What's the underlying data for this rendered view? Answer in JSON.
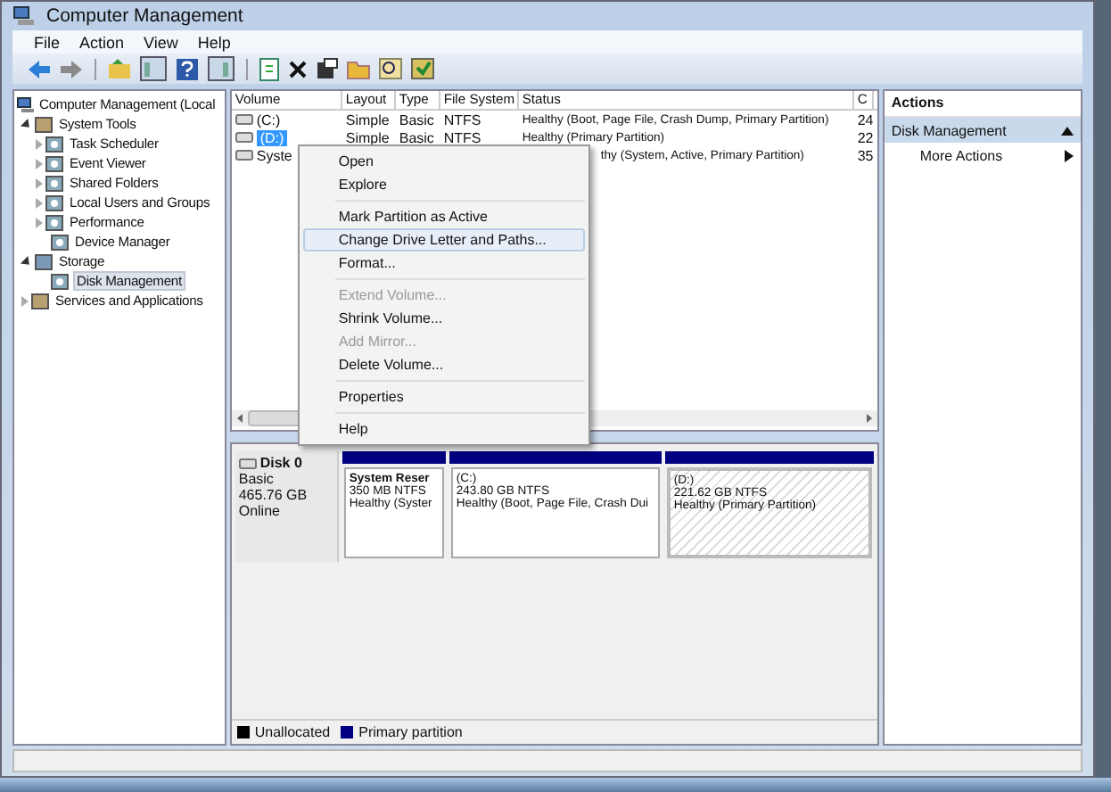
{
  "window": {
    "title": "Computer Management"
  },
  "menu_bar": [
    "File",
    "Action",
    "View",
    "Help"
  ],
  "tree": {
    "label": "Computer Management (Local",
    "children": [
      {
        "label": "System Tools",
        "expanded": true,
        "selected": false,
        "children": [
          {
            "label": "Task Scheduler",
            "expanded": false,
            "selected": false
          },
          {
            "label": "Event Viewer",
            "expanded": false,
            "selected": false
          },
          {
            "label": "Shared Folders",
            "expanded": false,
            "selected": false
          },
          {
            "label": "Local Users and Groups",
            "expanded": false,
            "selected": false
          },
          {
            "label": "Performance",
            "expanded": false,
            "selected": false
          },
          {
            "label": "Device Manager",
            "selected": false
          }
        ]
      },
      {
        "label": "Storage",
        "expanded": true,
        "selected": false,
        "children": [
          {
            "label": "Disk Management",
            "selected": true
          }
        ]
      },
      {
        "label": "Services and Applications",
        "expanded": false,
        "selected": false
      }
    ]
  },
  "volume_table": {
    "columns": [
      "Volume",
      "Layout",
      "Type",
      "File System",
      "Status",
      "C"
    ],
    "rows": [
      {
        "volume": "(C:)",
        "layout": "Simple",
        "type": "Basic",
        "file_system": "NTFS",
        "status": "Healthy (Boot, Page File, Crash Dump, Primary Partition)",
        "column_6": "24",
        "selected": false
      },
      {
        "volume": "(D:)",
        "layout": "Simple",
        "type": "Basic",
        "file_system": "NTFS",
        "status": "Healthy (Primary Partition)",
        "column_6": "22",
        "selected": true
      },
      {
        "volume": "Syste",
        "status": "thy (System, Active, Primary Partition)",
        "column_6": "35",
        "selected": false
      }
    ]
  },
  "context_menu": [
    {
      "kind": "item",
      "label": "Open",
      "disabled": false,
      "selected": false
    },
    {
      "kind": "item",
      "label": "Explore",
      "disabled": false,
      "selected": false
    },
    {
      "kind": "separator"
    },
    {
      "kind": "item",
      "label": "Mark Partition as Active",
      "disabled": false,
      "selected": false
    },
    {
      "kind": "item",
      "label": "Change Drive Letter and Paths...",
      "disabled": false,
      "selected": true
    },
    {
      "kind": "item",
      "label": "Format...",
      "disabled": false,
      "selected": false
    },
    {
      "kind": "separator"
    },
    {
      "kind": "item",
      "label": "Extend Volume...",
      "disabled": true,
      "selected": false
    },
    {
      "kind": "item",
      "label": "Shrink Volume...",
      "disabled": false,
      "selected": false
    },
    {
      "kind": "item",
      "label": "Add Mirror...",
      "disabled": true,
      "selected": false
    },
    {
      "kind": "item",
      "label": "Delete Volume...",
      "disabled": false,
      "selected": false
    },
    {
      "kind": "separator"
    },
    {
      "kind": "item",
      "label": "Properties",
      "disabled": false,
      "selected": false
    },
    {
      "kind": "separator"
    },
    {
      "kind": "item",
      "label": "Help",
      "disabled": false,
      "selected": false
    }
  ],
  "disk": {
    "name": "Disk 0",
    "lines": [
      "Basic",
      "465.76 GB",
      "Online"
    ],
    "partitions": [
      {
        "name": "System Reser",
        "size": "350 MB NTFS",
        "status": "Healthy (Syster",
        "selected": false,
        "color": "#000080"
      },
      {
        "name": "(C:)",
        "size": "243.80 GB NTFS",
        "status": "Healthy (Boot, Page File, Crash Dui",
        "selected": false,
        "color": "#000080"
      },
      {
        "name": "(D:)",
        "size": "221.62 GB NTFS",
        "status": "Healthy (Primary Partition)",
        "selected": true,
        "color": "#000080"
      }
    ]
  },
  "legend": [
    {
      "label": "Unallocated",
      "color": "#000000"
    },
    {
      "label": "Primary partition",
      "color": "#000080"
    }
  ],
  "actions": {
    "title": "Actions",
    "section": "Disk Management",
    "items": [
      "More Actions"
    ]
  }
}
